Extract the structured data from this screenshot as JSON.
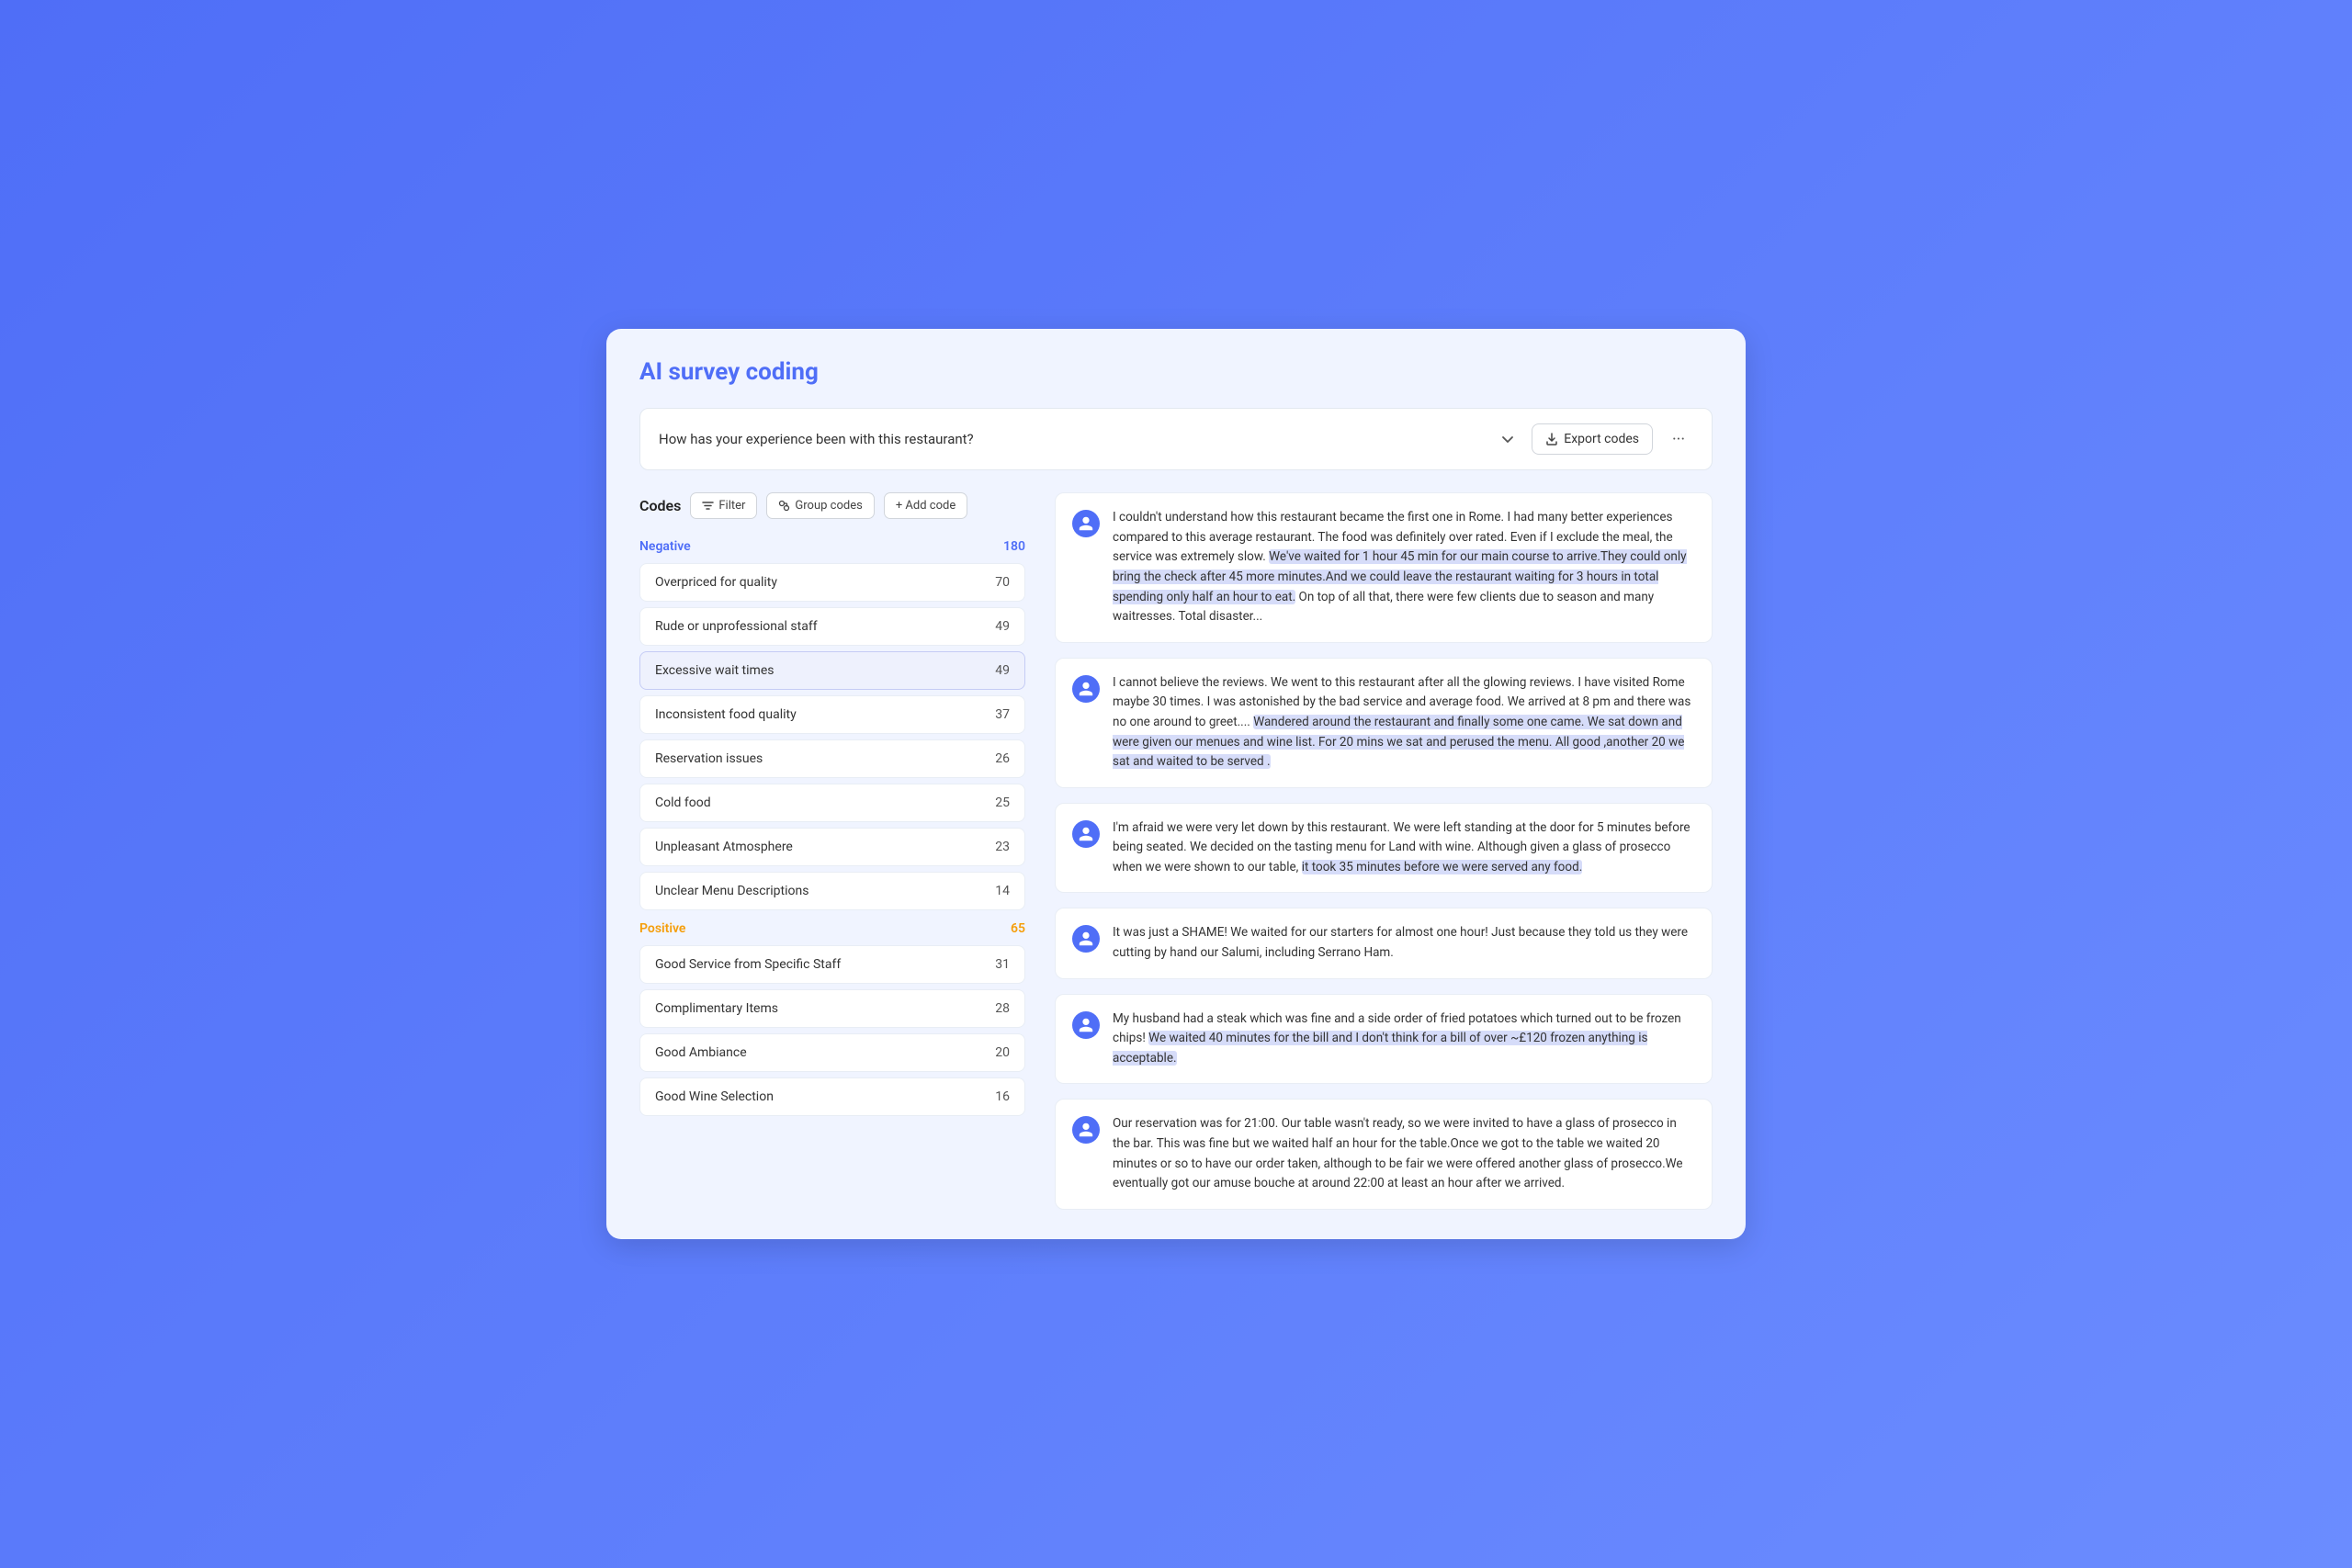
{
  "app": {
    "title": "AI survey coding"
  },
  "question": {
    "text": "How has your experience been with this restaurant?"
  },
  "toolbar": {
    "export_label": "Export codes",
    "filter_label": "Filter",
    "group_codes_label": "Group codes",
    "add_code_label": "+ Add code",
    "codes_title": "Codes"
  },
  "categories": [
    {
      "id": "negative",
      "label": "Negative",
      "count": "180",
      "type": "negative",
      "codes": [
        {
          "name": "Overpriced for quality",
          "count": "70",
          "active": false
        },
        {
          "name": "Rude or unprofessional staff",
          "count": "49",
          "active": false
        },
        {
          "name": "Excessive wait times",
          "count": "49",
          "active": true
        },
        {
          "name": "Inconsistent food quality",
          "count": "37",
          "active": false
        },
        {
          "name": "Reservation issues",
          "count": "26",
          "active": false
        },
        {
          "name": "Cold food",
          "count": "25",
          "active": false
        },
        {
          "name": "Unpleasant Atmosphere",
          "count": "23",
          "active": false
        },
        {
          "name": "Unclear Menu Descriptions",
          "count": "14",
          "active": false
        }
      ]
    },
    {
      "id": "positive",
      "label": "Positive",
      "count": "65",
      "type": "positive",
      "codes": [
        {
          "name": "Good Service from Specific Staff",
          "count": "31",
          "active": false
        },
        {
          "name": "Complimentary Items",
          "count": "28",
          "active": false
        },
        {
          "name": "Good Ambiance",
          "count": "20",
          "active": false
        },
        {
          "name": "Good Wine Selection",
          "count": "16",
          "active": false
        }
      ]
    }
  ],
  "reviews": [
    {
      "id": 1,
      "text_parts": [
        {
          "text": "I couldn't understand how this restaurant became the first one in Rome. I had many better experiences compared to this average restaurant. The food was definitely over rated. Even if I exclude the meal, the service was extremely slow. ",
          "highlight": false
        },
        {
          "text": "We've waited for 1 hour 45 min for our main course to arrive.They could only bring the check after 45 more minutes.And we could leave the restaurant waiting for 3 hours in total spending only half an hour to eat.",
          "highlight": true
        },
        {
          "text": " On top of all that, there were few clients due to season and many waitresses. Total disaster...",
          "highlight": false
        }
      ]
    },
    {
      "id": 2,
      "text_parts": [
        {
          "text": "I cannot believe the reviews. We went to this restaurant after all the glowing reviews. I have visited Rome maybe 30 times. I was astonished by the bad service and average food. We arrived at 8 pm and there was no one around to greet.... ",
          "highlight": false
        },
        {
          "text": "Wandered around the restaurant and finally some one came. We sat down and were given our menues and wine list. For 20 mins we sat and perused the menu. All good ,another 20 we sat and waited to be served .",
          "highlight": true
        }
      ]
    },
    {
      "id": 3,
      "text_parts": [
        {
          "text": "I'm afraid we were very let down by this restaurant. We were left standing at the door for 5 minutes before being seated. We decided on the tasting menu for Land with wine. Although given a glass of prosecco when we were shown to our table, ",
          "highlight": false
        },
        {
          "text": "it took 35 minutes before we were served any food.",
          "highlight": true
        }
      ]
    },
    {
      "id": 4,
      "text_parts": [
        {
          "text": "It was just a SHAME! We waited for our starters for almost one hour! Just because they told us they were cutting by hand our Salumi, including Serrano Ham.",
          "highlight": false
        }
      ]
    },
    {
      "id": 5,
      "text_parts": [
        {
          "text": "My husband had a steak which was fine and a side order of fried potatoes which turned out to be frozen chips! ",
          "highlight": false
        },
        {
          "text": "We waited 40 minutes for the bill and I don't think for a bill of over ~£120 frozen anything is acceptable.",
          "highlight": true
        }
      ]
    },
    {
      "id": 6,
      "text_parts": [
        {
          "text": "Our reservation was for 21:00. Our table wasn't ready, so we were invited to have a glass of prosecco in the bar. This was fine but we waited half an hour for the table.Once we got to the table we waited 20 minutes or so to have our order taken, although to be fair we were offered another glass of prosecco.We eventually got our amuse bouche at around 22:00 at least an hour after we arrived.",
          "highlight": false
        }
      ]
    }
  ]
}
